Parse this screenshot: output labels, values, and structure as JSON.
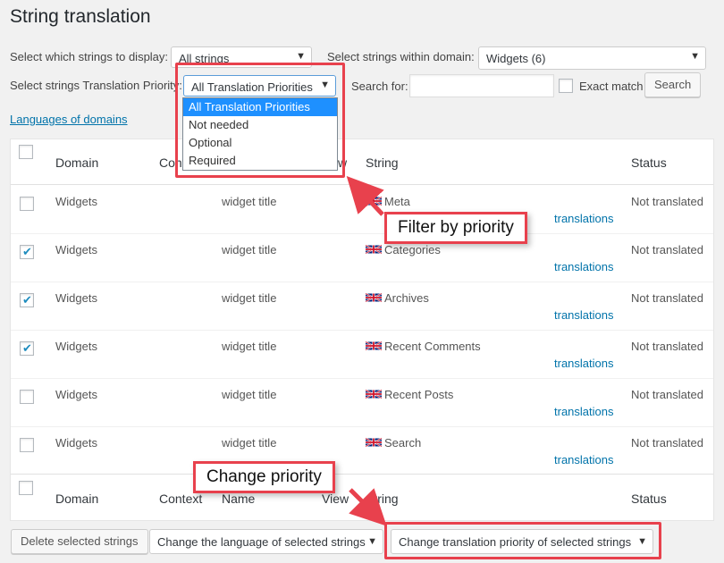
{
  "page": {
    "title": "String translation"
  },
  "filters": {
    "display_label": "Select which strings to display:",
    "display_value": "All strings",
    "domain_label": "Select strings within domain:",
    "domain_value": "Widgets (6)",
    "priority_label": "Select strings Translation Priority:",
    "priority_value": "All Translation Priorities",
    "priority_options": [
      "All Translation Priorities",
      "Not needed",
      "Optional",
      "Required"
    ],
    "search_label": "Search for:",
    "search_value": "",
    "exact_match_label": "Exact match",
    "search_button": "Search"
  },
  "languages_link": "Languages of domains",
  "table": {
    "headers": {
      "domain": "Domain",
      "context": "Context",
      "name": "Name",
      "view": "View",
      "string": "String",
      "status": "Status"
    },
    "header_partial_context": "Cont",
    "header_partial_view": "w",
    "rows": [
      {
        "domain": "Widgets",
        "name": "widget title",
        "string": "Meta",
        "status": "Not translated",
        "translations": "translations",
        "checked": false
      },
      {
        "domain": "Widgets",
        "name": "widget title",
        "string": "Categories",
        "status": "Not translated",
        "translations": "translations",
        "checked": true
      },
      {
        "domain": "Widgets",
        "name": "widget title",
        "string": "Archives",
        "status": "Not translated",
        "translations": "translations",
        "checked": true
      },
      {
        "domain": "Widgets",
        "name": "widget title",
        "string": "Recent Comments",
        "status": "Not translated",
        "translations": "translations",
        "checked": true
      },
      {
        "domain": "Widgets",
        "name": "widget title",
        "string": "Recent Posts",
        "status": "Not translated",
        "translations": "translations",
        "checked": false
      },
      {
        "domain": "Widgets",
        "name": "widget title",
        "string": "Search",
        "status": "Not translated",
        "translations": "translations",
        "checked": false
      }
    ]
  },
  "actions": {
    "delete": "Delete selected strings",
    "change_language": "Change the language of selected strings",
    "change_priority": "Change translation priority of selected strings"
  },
  "callouts": {
    "filter": "Filter by priority",
    "change": "Change priority"
  },
  "colors": {
    "highlight": "#e8414d",
    "link": "#0073aa",
    "selected_option": "#1e90ff"
  },
  "icons": {
    "flag": "uk-flag-icon",
    "dropdown_arrow": "chevron-down-icon"
  }
}
